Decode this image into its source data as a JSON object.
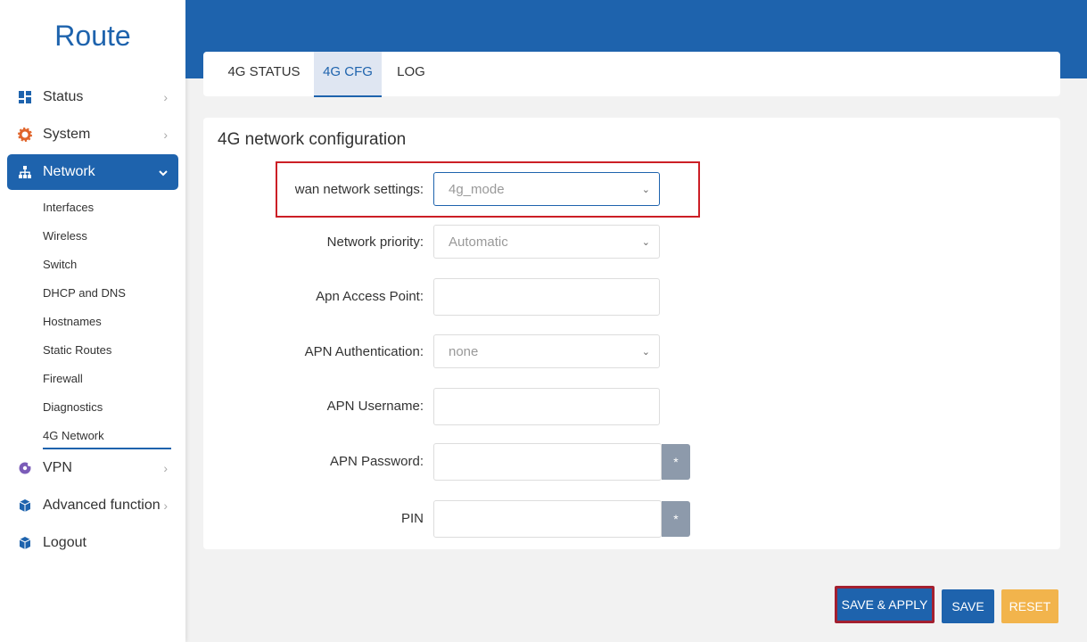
{
  "app": {
    "title": "Route"
  },
  "sidebar": {
    "items": [
      {
        "label": "Status",
        "icon": "dashboard-icon"
      },
      {
        "label": "System",
        "icon": "gear-icon"
      },
      {
        "label": "Network",
        "icon": "network-icon"
      },
      {
        "label": "VPN",
        "icon": "vpn-icon"
      },
      {
        "label": "Advanced function",
        "icon": "cube-icon"
      },
      {
        "label": "Logout",
        "icon": "cube-icon"
      }
    ],
    "network_sub": [
      "Interfaces",
      "Wireless",
      "Switch",
      "DHCP and DNS",
      "Hostnames",
      "Static Routes",
      "Firewall",
      "Diagnostics",
      "4G Network"
    ]
  },
  "tabs": [
    "4G STATUS",
    "4G CFG",
    "LOG"
  ],
  "panel": {
    "title": "4G network configuration",
    "wan_label": "wan network settings:",
    "wan_value": "4g_mode",
    "priority_label": "Network priority:",
    "priority_value": "Automatic",
    "apn_label": "Apn Access Point:",
    "auth_label": "APN Authentication:",
    "auth_value": "none",
    "username_label": "APN Username:",
    "password_label": "APN Password:",
    "pin_label": "PIN",
    "reveal_symbol": "*"
  },
  "buttons": {
    "save_apply": "SAVE & APPLY",
    "save": "SAVE",
    "reset": "RESET"
  },
  "colors": {
    "primary": "#1e63ad",
    "reset": "#f2b44c",
    "highlight": "#cc1f26"
  }
}
